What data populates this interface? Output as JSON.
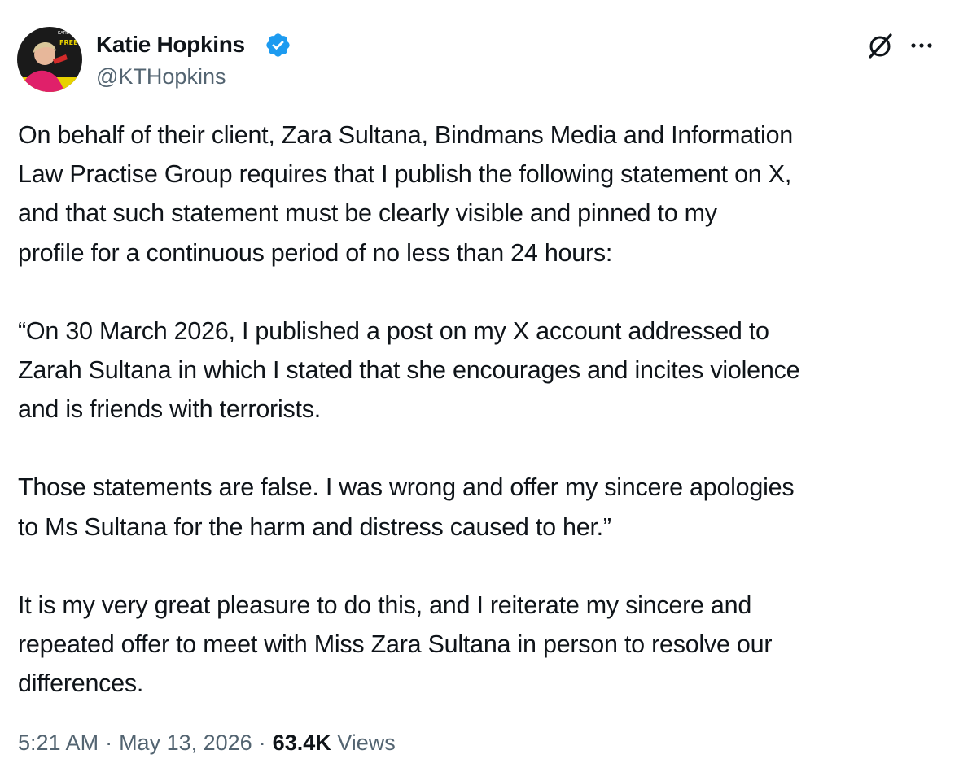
{
  "author": {
    "display_name": "Katie Hopkins",
    "handle": "@KTHopkins",
    "verified": true,
    "avatar_icon": "avatar-photo",
    "avatar_text_top": "KATIE HO",
    "avatar_text_main": "FREE RANGE"
  },
  "actions": {
    "grok_icon": "grok-icon",
    "more_icon": "more-icon"
  },
  "post": {
    "paragraphs": [
      "On behalf of their client, Zara Sultana, Bindmans Media and Information\nLaw Practise Group requires that I publish the following statement on X,\nand that such statement must be clearly visible and pinned to my\nprofile for a continuous period of no less than 24 hours:",
      "“On 30 March 2026, I published a post on my X account addressed to\nZarah Sultana in which I stated that she encourages and incites violence\nand is friends with terrorists.",
      "Those statements are false. I was wrong and offer my sincere apologies\nto Ms Sultana for the harm and distress caused to her.”",
      "It is my very great pleasure to do this, and I reiterate my sincere and\nrepeated offer to meet with Miss Zara Sultana in person to resolve our\ndifferences."
    ]
  },
  "meta": {
    "time": "5:21 AM",
    "separator": "·",
    "date": "May 13, 2026",
    "views_count": "63.4K",
    "views_label": "Views"
  },
  "colors": {
    "text": "#0f1419",
    "secondary": "#536471",
    "verified": "#1d9bf0"
  }
}
